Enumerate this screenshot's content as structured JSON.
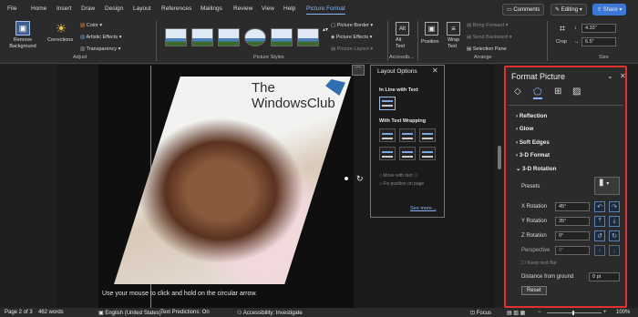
{
  "menu": {
    "items": [
      "File",
      "Home",
      "Insert",
      "Draw",
      "Design",
      "Layout",
      "References",
      "Mailings",
      "Review",
      "View",
      "Help",
      "Picture Format"
    ]
  },
  "top_right": {
    "comments": "Comments",
    "editing": "Editing",
    "share": "Share"
  },
  "ribbon": {
    "remove_background": "Remove Background",
    "corrections": "Corrections",
    "color": "Color",
    "artistic_effects": "Artistic Effects",
    "transparency": "Transparency",
    "group_adjust": "Adjust",
    "picture_border": "Picture Border",
    "picture_effects": "Picture Effects",
    "picture_layout": "Picture Layout",
    "group_styles": "Picture Styles",
    "alt_text": "Alt Text",
    "group_accessibility": "Accessib...",
    "position": "Position",
    "wrap_text": "Wrap Text",
    "bring_forward": "Bring Forward",
    "send_backward": "Send Backward",
    "selection_pane": "Selection Pane",
    "group_arrange": "Arrange",
    "crop": "Crop",
    "height": "4.33\"",
    "width": "6.5\"",
    "group_size": "Size"
  },
  "document": {
    "watermark_line1": "The",
    "watermark_line2": "WindowsClub",
    "caption": "Use your mouse to click and hold on the circular arrow."
  },
  "layout_options": {
    "title": "Layout Options",
    "inline": "In Line with Text",
    "with_wrapping": "With Text Wrapping",
    "move_with_text": "Move with text",
    "fix_position": "Fix position on page",
    "see_more": "See more..."
  },
  "format_picture": {
    "title": "Format Picture",
    "sections": [
      "Reflection",
      "Glow",
      "Soft Edges",
      "3-D Format",
      "3-D Rotation"
    ],
    "presets": "Presets",
    "x_rotation_label": "X Rotation",
    "x_rotation": "45°",
    "y_rotation_label": "Y Rotation",
    "y_rotation": "35°",
    "z_rotation_label": "Z Rotation",
    "z_rotation": "0°",
    "perspective_label": "Perspective",
    "perspective": "0°",
    "keep_text_flat": "Keep text flat",
    "distance_label": "Distance from ground",
    "distance": "0 pt",
    "reset": "Reset"
  },
  "status": {
    "page": "Page 2 of 3",
    "words": "462 words",
    "language": "English (United States)",
    "predictions": "Text Predictions: On",
    "accessibility": "Accessibility: Investigate",
    "focus": "Focus",
    "zoom": "100%"
  },
  "colors": {
    "accent": "#8ab4f8",
    "highlight_border": "#e03030",
    "share": "#3b78d8"
  }
}
